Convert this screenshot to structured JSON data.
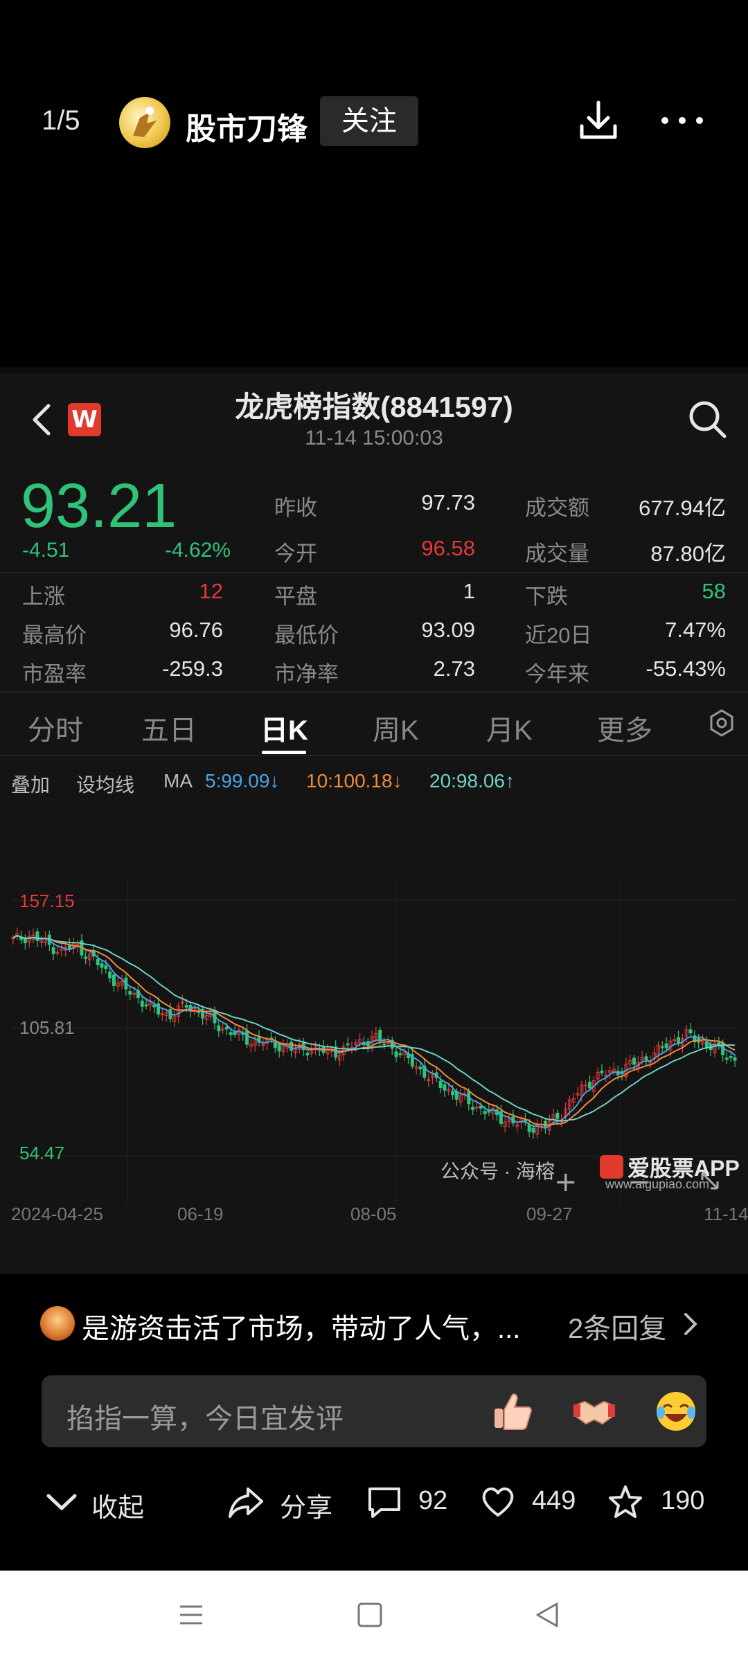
{
  "header": {
    "counter": "1/5",
    "username": "股市刀锋",
    "follow_label": "关注",
    "icons": [
      "avatar",
      "download-icon",
      "more-icon"
    ]
  },
  "stock": {
    "title": "龙虎榜指数(8841597)",
    "time": "11-14 15:00:03",
    "price": "93.21",
    "change": "-4.51",
    "change_pct": "-4.62%",
    "quotes_top": [
      {
        "label": "昨收",
        "value": "97.73",
        "label2": "成交额",
        "value2": "677.94亿"
      },
      {
        "label": "今开",
        "value": "96.58",
        "label2": "成交量",
        "value2": "87.80亿"
      }
    ],
    "stats": [
      [
        {
          "label": "上涨",
          "value": "12"
        },
        {
          "label": "平盘",
          "value": "1"
        },
        {
          "label": "下跌",
          "value": "58"
        }
      ],
      [
        {
          "label": "最高价",
          "value": "96.76"
        },
        {
          "label": "最低价",
          "value": "93.09"
        },
        {
          "label": "近20日",
          "value": "7.47%"
        }
      ],
      [
        {
          "label": "市盈率",
          "value": "-259.3"
        },
        {
          "label": "市净率",
          "value": "2.73"
        },
        {
          "label": "今年来",
          "value": "-55.43%"
        }
      ]
    ],
    "tabs": [
      "分时",
      "五日",
      "日K",
      "周K",
      "月K",
      "更多"
    ],
    "active_tab": "日K",
    "ma_bar": {
      "overlay": "叠加",
      "set_ma": "设均线",
      "ma_label": "MA",
      "ma5": "5:99.09↓",
      "ma10": "10:100.18↓",
      "ma20": "20:98.06↑"
    },
    "colors": {
      "up": "#e23a3a",
      "down": "#2fc37a",
      "ma5": "#4aa3df",
      "ma10": "#f08a3c",
      "ma20": "#6fd0c4"
    },
    "watermark_text": "公众号 · 海榕",
    "watermark_brand": "爱股票APP",
    "watermark_url": "www.aigupiao.com"
  },
  "chart_data": {
    "type": "candlestick",
    "y_labels": [
      "157.15",
      "105.81",
      "54.47"
    ],
    "ylim": [
      54.47,
      157.15
    ],
    "x_labels": [
      "2024-04-25",
      "06-19",
      "08-05",
      "09-27",
      "11-14"
    ],
    "ma5_end": 99.09,
    "ma10_end": 100.18,
    "ma20_end": 98.06,
    "close_path": [
      141,
      143,
      140,
      137,
      139,
      134,
      128,
      122,
      118,
      113,
      111,
      115,
      112,
      107,
      104,
      101,
      100,
      99,
      97,
      98,
      96,
      97,
      100,
      102,
      99,
      94,
      89,
      84,
      80,
      76,
      73,
      70,
      68,
      66,
      67,
      72,
      80,
      86,
      88,
      90,
      93,
      96,
      101,
      103,
      100,
      97,
      93
    ]
  },
  "comment": {
    "text": "是游资击活了市场，带动了人气，...",
    "replies": "2条回复",
    "input_placeholder": "掐指一算，今日宜发评",
    "emojis": [
      "thumbs-up-icon",
      "handshake-icon",
      "laughing-icon"
    ]
  },
  "actions": {
    "collapse": "收起",
    "share": "分享",
    "comments": "92",
    "likes": "449",
    "favorites": "190"
  }
}
